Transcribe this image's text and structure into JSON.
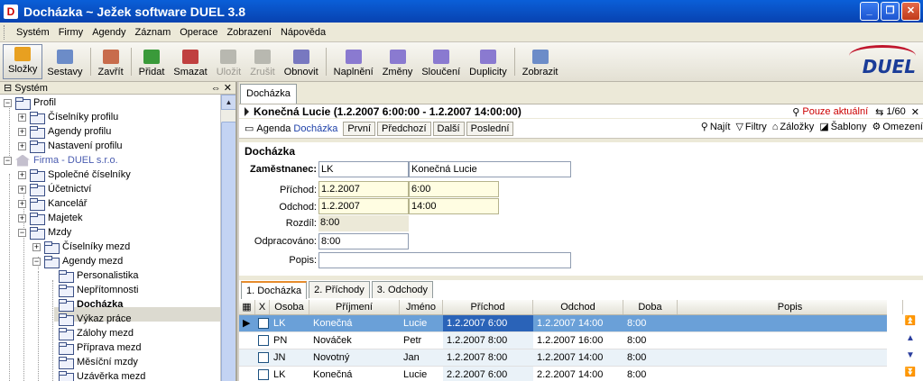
{
  "window": {
    "title": "Docházka ~ Ježek software DUEL 3.8",
    "app_icon": "D"
  },
  "menu": [
    "Systém",
    "Firmy",
    "Agendy",
    "Záznam",
    "Operace",
    "Zobrazení",
    "Nápověda"
  ],
  "toolbar": [
    {
      "label": "Složky",
      "icon": "folders-icon",
      "active": true,
      "disabled": false,
      "color": "#e8a020"
    },
    {
      "label": "Sestavy",
      "icon": "reports-icon",
      "active": false,
      "disabled": false,
      "color": "#6c8cc8"
    },
    {
      "label": "Zavřít",
      "icon": "close-doc-icon",
      "active": false,
      "disabled": false,
      "color": "#c86c4c"
    },
    {
      "label": "Přidat",
      "icon": "add-record-icon",
      "active": false,
      "disabled": false,
      "color": "#3a9a3a"
    },
    {
      "label": "Smazat",
      "icon": "delete-record-icon",
      "active": false,
      "disabled": false,
      "color": "#c04040"
    },
    {
      "label": "Uložit",
      "icon": "save-icon",
      "active": false,
      "disabled": true,
      "color": "#b8b8b0"
    },
    {
      "label": "Zrušit",
      "icon": "cancel-icon",
      "active": false,
      "disabled": true,
      "color": "#b8b8b0"
    },
    {
      "label": "Obnovit",
      "icon": "refresh-icon",
      "active": false,
      "disabled": false,
      "color": "#7878c0"
    },
    {
      "label": "Naplnění",
      "icon": "fill-icon",
      "active": false,
      "disabled": false,
      "color": "#8a7ad0"
    },
    {
      "label": "Změny",
      "icon": "changes-icon",
      "active": false,
      "disabled": false,
      "color": "#8a7ad0"
    },
    {
      "label": "Sloučení",
      "icon": "merge-icon",
      "active": false,
      "disabled": false,
      "color": "#8a7ad0"
    },
    {
      "label": "Duplicity",
      "icon": "duplicates-icon",
      "active": false,
      "disabled": false,
      "color": "#8a7ad0"
    },
    {
      "label": "Zobrazit",
      "icon": "view-icon",
      "active": false,
      "disabled": false,
      "color": "#6c8cc8"
    }
  ],
  "logo": "DUEL",
  "leftpane": {
    "title": "Systém"
  },
  "tree": [
    {
      "label": "Profil",
      "level": 0,
      "expander": "−",
      "icon": "profile-icon"
    },
    {
      "label": "Číselníky profilu",
      "level": 1,
      "expander": "+",
      "icon": "folder-icon"
    },
    {
      "label": "Agendy profilu",
      "level": 1,
      "expander": "+",
      "icon": "folder-icon"
    },
    {
      "label": "Nastavení profilu",
      "level": 1,
      "expander": "+",
      "icon": "folder-icon"
    },
    {
      "label": "Firma - DUEL s.r.o.",
      "level": 0,
      "expander": "−",
      "icon": "company-icon"
    },
    {
      "label": "Společné číselníky",
      "level": 1,
      "expander": "+",
      "icon": "folder-icon"
    },
    {
      "label": "Účetnictví",
      "level": 1,
      "expander": "+",
      "icon": "folder-icon"
    },
    {
      "label": "Kancelář",
      "level": 1,
      "expander": "+",
      "icon": "folder-icon"
    },
    {
      "label": "Majetek",
      "level": 1,
      "expander": "+",
      "icon": "folder-icon"
    },
    {
      "label": "Mzdy",
      "level": 1,
      "expander": "−",
      "icon": "folder-icon"
    },
    {
      "label": "Číselníky mezd",
      "level": 2,
      "expander": "+",
      "icon": "folder-icon"
    },
    {
      "label": "Agendy mezd",
      "level": 2,
      "expander": "−",
      "icon": "folder-icon"
    },
    {
      "label": "Personalistika",
      "level": 3,
      "expander": "",
      "icon": "folder-icon"
    },
    {
      "label": "Nepřítomnosti",
      "level": 3,
      "expander": "",
      "icon": "folder-icon"
    },
    {
      "label": "Docházka",
      "level": 3,
      "expander": "",
      "icon": "folder-icon",
      "selected": true
    },
    {
      "label": "Výkaz práce",
      "level": 3,
      "expander": "",
      "icon": "folder-icon"
    },
    {
      "label": "Zálohy mezd",
      "level": 3,
      "expander": "",
      "icon": "folder-icon"
    },
    {
      "label": "Příprava mezd",
      "level": 3,
      "expander": "",
      "icon": "folder-icon"
    },
    {
      "label": "Měsíční mzdy",
      "level": 3,
      "expander": "",
      "icon": "folder-icon"
    },
    {
      "label": "Uzávěrka mezd",
      "level": 3,
      "expander": "",
      "icon": "folder-icon"
    }
  ],
  "doc_tab": "Docházka",
  "record": {
    "title": "Konečná Lucie (1.2.2007 6:00:00 - 1.2.2007 14:00:00)",
    "filter": "Pouze aktuální",
    "counter": "1/60"
  },
  "nav": {
    "agenda_label": "Agenda",
    "agenda_name": "Docházka",
    "buttons": [
      "První",
      "Předchozí",
      "Další",
      "Poslední"
    ],
    "right": [
      {
        "label": "Najít",
        "icon": "find-icon"
      },
      {
        "label": "Filtry",
        "icon": "filter-icon"
      },
      {
        "label": "Záložky",
        "icon": "bookmarks-icon"
      },
      {
        "label": "Šablony",
        "icon": "templates-icon"
      },
      {
        "label": "Omezení",
        "icon": "restrictions-icon"
      }
    ]
  },
  "form": {
    "section": "Docházka",
    "employee_label": "Zaměstnanec:",
    "employee_code": "LK",
    "employee_name": "Konečná Lucie",
    "arrival_label": "Příchod:",
    "arrival_date": "1.2.2007",
    "arrival_time": "6:00",
    "departure_label": "Odchod:",
    "departure_date": "1.2.2007",
    "departure_time": "14:00",
    "diff_label": "Rozdíl:",
    "diff_value": "8:00",
    "worked_label": "Odpracováno:",
    "worked_value": "8:00",
    "note_label": "Popis:",
    "note_value": ""
  },
  "bottom_tabs": [
    "1. Docházka",
    "2. Příchody",
    "3. Odchody"
  ],
  "grid": {
    "columns": [
      "Osoba",
      "Příjmení",
      "Jméno",
      "Příchod",
      "Odchod",
      "Doba",
      "Popis"
    ],
    "rows": [
      {
        "osoba": "LK",
        "prijmeni": "Konečná",
        "jmeno": "Lucie",
        "prichod": "1.2.2007 6:00",
        "odchod": "1.2.2007 14:00",
        "doba": "8:00",
        "popis": ""
      },
      {
        "osoba": "PN",
        "prijmeni": "Nováček",
        "jmeno": "Petr",
        "prichod": "1.2.2007 8:00",
        "odchod": "1.2.2007 16:00",
        "doba": "8:00",
        "popis": ""
      },
      {
        "osoba": "JN",
        "prijmeni": "Novotný",
        "jmeno": "Jan",
        "prichod": "1.2.2007 8:00",
        "odchod": "1.2.2007 14:00",
        "doba": "8:00",
        "popis": ""
      },
      {
        "osoba": "LK",
        "prijmeni": "Konečná",
        "jmeno": "Lucie",
        "prichod": "2.2.2007 6:00",
        "odchod": "2.2.2007 14:00",
        "doba": "8:00",
        "popis": ""
      }
    ]
  },
  "colors": {
    "titlebar": "#0a5fd8",
    "selection": "#6aa0d8",
    "accent_tab": "#e68b2c",
    "filter_text": "#cc0000",
    "logo_blue": "#1a3c98",
    "logo_red": "#c0162d"
  }
}
